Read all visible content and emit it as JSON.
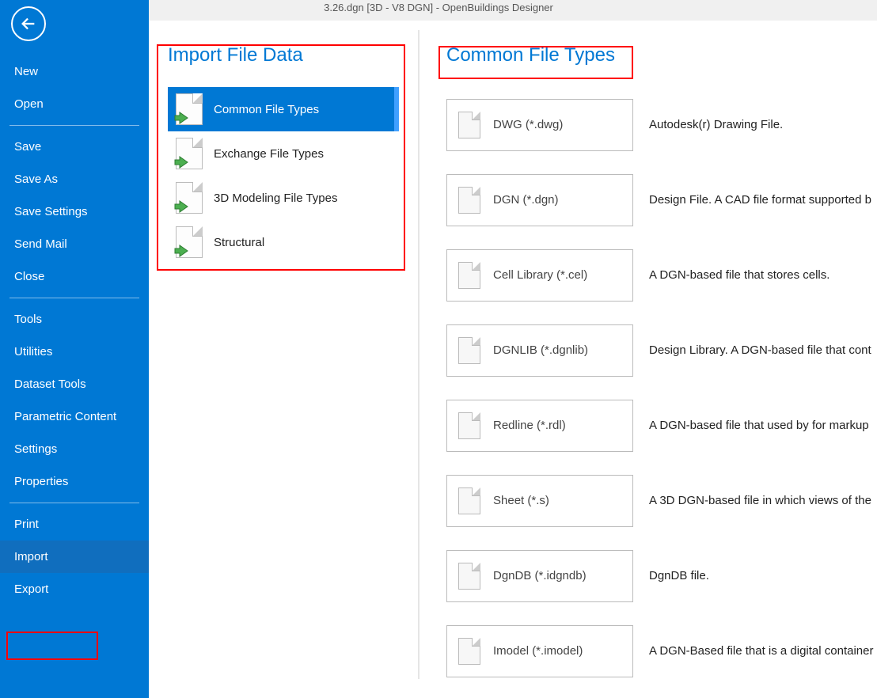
{
  "titlebar": "3.26.dgn [3D - V8 DGN] - OpenBuildings Designer",
  "sidebar": {
    "items": [
      {
        "label": "New"
      },
      {
        "label": "Open"
      },
      {
        "sep": true
      },
      {
        "label": "Save"
      },
      {
        "label": "Save As"
      },
      {
        "label": "Save Settings"
      },
      {
        "label": "Send Mail"
      },
      {
        "label": "Close"
      },
      {
        "sep": true
      },
      {
        "label": "Tools"
      },
      {
        "label": "Utilities"
      },
      {
        "label": "Dataset Tools"
      },
      {
        "label": "Parametric Content"
      },
      {
        "label": "Settings"
      },
      {
        "label": "Properties"
      },
      {
        "sep": true
      },
      {
        "label": "Print"
      },
      {
        "label": "Import",
        "selected": true
      },
      {
        "label": "Export"
      }
    ]
  },
  "middle": {
    "title": "Import File Data",
    "cats": [
      {
        "label": "Common File Types",
        "selected": true
      },
      {
        "label": "Exchange File Types"
      },
      {
        "label": "3D Modeling File Types"
      },
      {
        "label": "Structural"
      }
    ]
  },
  "right": {
    "title": "Common File Types",
    "files": [
      {
        "label": "DWG (*.dwg)",
        "desc": "Autodesk(r) Drawing File."
      },
      {
        "label": "DGN (*.dgn)",
        "desc": "Design File.  A CAD file format supported b"
      },
      {
        "label": "Cell Library (*.cel)",
        "desc": "A DGN-based file that stores cells."
      },
      {
        "label": "DGNLIB (*.dgnlib)",
        "desc": "Design Library.  A DGN-based file that cont"
      },
      {
        "label": "Redline (*.rdl)",
        "desc": "A DGN-based file that used by for markup "
      },
      {
        "label": "Sheet (*.s)",
        "desc": "A 3D DGN-based file in which views of the "
      },
      {
        "label": "DgnDB (*.idgndb)",
        "desc": "DgnDB file."
      },
      {
        "label": "Imodel (*.imodel)",
        "desc": "A DGN-Based file that is a digital container"
      }
    ]
  }
}
